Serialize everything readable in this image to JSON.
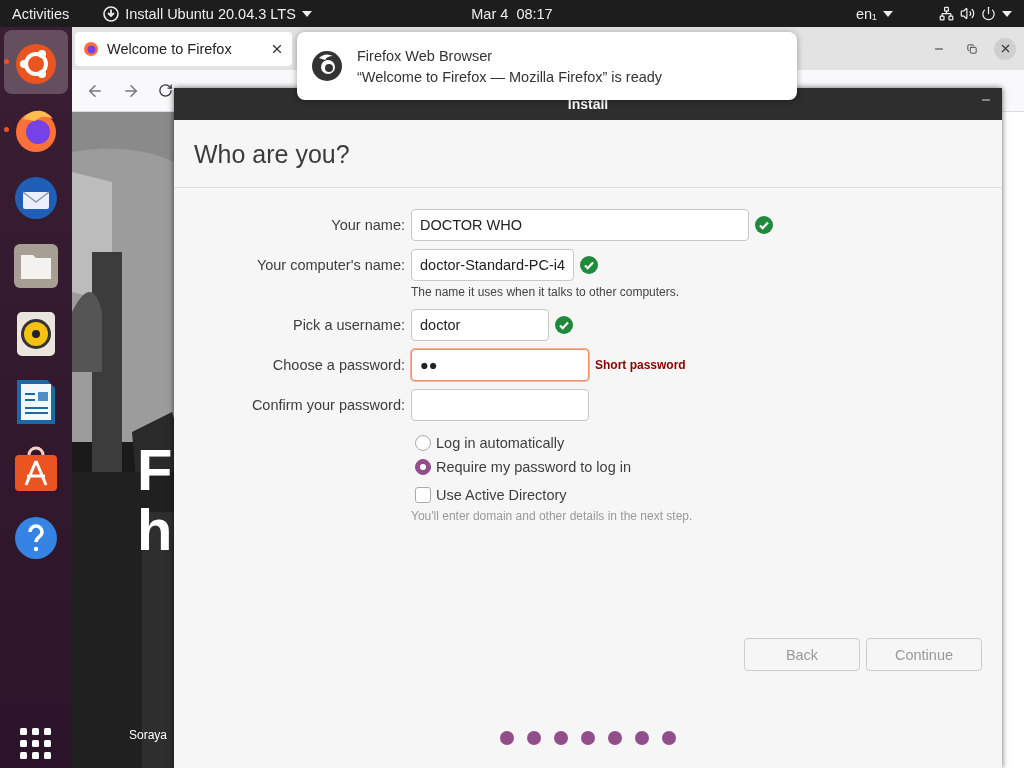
{
  "top_bar": {
    "activities": "Activities",
    "app_menu": "Install Ubuntu 20.04.3 LTS",
    "clock": "Mar 4  08:17",
    "input_source": "en₁"
  },
  "dock": {
    "items": [
      {
        "kind": "installer",
        "selected": true,
        "running": true
      },
      {
        "kind": "firefox",
        "selected": false,
        "running": true
      },
      {
        "kind": "thunderbird",
        "selected": false,
        "running": false
      },
      {
        "kind": "files",
        "selected": false,
        "running": false
      },
      {
        "kind": "rhythmbox",
        "selected": false,
        "running": false
      },
      {
        "kind": "writer",
        "selected": false,
        "running": false
      },
      {
        "kind": "software",
        "selected": false,
        "running": false
      },
      {
        "kind": "help",
        "selected": false,
        "running": false
      }
    ]
  },
  "browser": {
    "tab": {
      "title": "Welcome to Firefox"
    },
    "page": {
      "heading_lines": [
        "F",
        "h"
      ],
      "credit": "Soraya"
    }
  },
  "notification": {
    "app": "Firefox Web Browser",
    "message": "“Welcome to Firefox — Mozilla Firefox” is ready"
  },
  "installer": {
    "title": "Install",
    "heading": "Who are you?",
    "fields": [
      {
        "kind": "name",
        "label": "Your name:",
        "value": "DOCTOR WHO",
        "valid": true,
        "error": false
      },
      {
        "kind": "hostname",
        "label": "Your computer's name:",
        "value": "doctor-Standard-PC-i4",
        "valid": true,
        "error": false,
        "hint": "The name it uses when it talks to other computers."
      },
      {
        "kind": "username",
        "label": "Pick a username:",
        "value": "doctor",
        "valid": true,
        "error": false
      },
      {
        "kind": "password",
        "label": "Choose a password:",
        "value": "●●",
        "valid": false,
        "error": true,
        "message": "Short password"
      },
      {
        "kind": "password",
        "label": "Confirm your password:",
        "valid": false,
        "error": false
      }
    ],
    "login_options": [
      {
        "label": "Log in automatically",
        "selected": false
      },
      {
        "label": "Require my password to log in",
        "selected": true
      }
    ],
    "active_directory": {
      "label": "Use Active Directory",
      "checked": false,
      "note": "You'll enter domain and other details in the next step."
    },
    "buttons": [
      {
        "label": "Back",
        "disabled": true
      },
      {
        "label": "Continue",
        "disabled": true
      }
    ],
    "progress": [
      {
        "done": true
      },
      {
        "done": true
      },
      {
        "done": true
      },
      {
        "done": true
      },
      {
        "done": true
      },
      {
        "done": true
      },
      {
        "done": true
      }
    ]
  }
}
